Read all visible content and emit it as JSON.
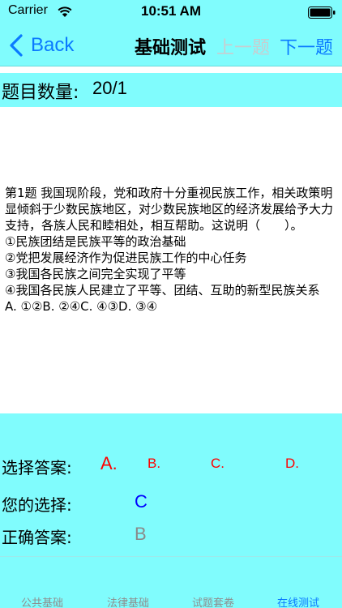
{
  "status_bar": {
    "carrier": "Carrier",
    "time": "10:51 AM",
    "icons": [
      "wifi-icon",
      "battery-icon"
    ]
  },
  "nav": {
    "back_label": "Back",
    "title": "基础测试",
    "prev_label": "上一题",
    "next_label": "下一题"
  },
  "count": {
    "label": "题目数量:",
    "value": "20/1"
  },
  "question": {
    "lines": [
      "第1题 我国现阶段，党和政府十分重视民族工作，相关政策明显倾斜于少数民族地区，对少数民族地区的经济发展给予大力支持，各族人民和睦相处，相互帮助。这说明（　　）。",
      "①民族团结是民族平等的政治基础",
      "②党把发展经济作为促进民族工作的中心任务",
      "③我国各民族之间完全实现了平等",
      "④我国各民族人民建立了平等、团结、互助的新型民族关系",
      "A. ①②B. ②④C. ④③D. ③④"
    ]
  },
  "answers": {
    "select_label": "选择答案:",
    "options": [
      "A.",
      "B.",
      "C.",
      "D."
    ],
    "your_choice_label": "您的选择:",
    "your_choice_value": "C",
    "correct_label": "正确答案:",
    "correct_value": "B"
  },
  "tabs": [
    {
      "label": "公共基础",
      "active": false
    },
    {
      "label": "法律基础",
      "active": false
    },
    {
      "label": "试题套卷",
      "active": false
    },
    {
      "label": "在线测试",
      "active": true
    }
  ],
  "colors": {
    "panel_bg": "#80fcfd",
    "accent_blue": "#0a7aff",
    "option_red": "#ff0000",
    "choice_blue": "#0000ff",
    "correct_gray": "#8a8a8a",
    "disabled_gray": "#c8cdd0"
  }
}
